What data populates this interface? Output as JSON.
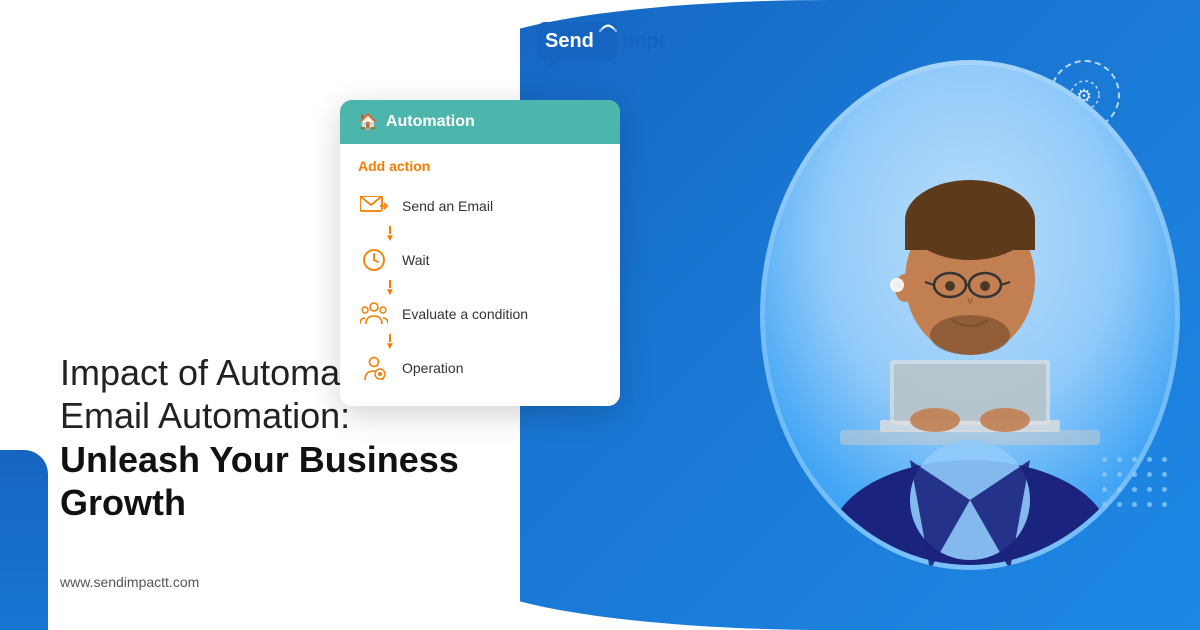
{
  "logo": {
    "send": "Send",
    "impactt": "impactt",
    "tagline": "Send impactt"
  },
  "headline": {
    "line1": "Impact of Automated",
    "line2": "Email Automation:",
    "line3": "Unleash Your Business",
    "line4": "Growth"
  },
  "website": "www.sendimpactt.com",
  "panel": {
    "header": "Automation",
    "add_action": "Add action",
    "items": [
      {
        "label": "Send an Email",
        "icon": "email"
      },
      {
        "label": "Wait",
        "icon": "clock"
      },
      {
        "label": "Evaluate a condition",
        "icon": "evaluate"
      },
      {
        "label": "Operation",
        "icon": "operation"
      }
    ]
  },
  "colors": {
    "blue_dark": "#1565c0",
    "blue_mid": "#1976d2",
    "blue_light": "#42a5f5",
    "teal": "#4db6ac",
    "orange": "#f57c00",
    "white": "#ffffff",
    "text_dark": "#111111",
    "text_mid": "#333333",
    "text_light": "#555555"
  },
  "dots": {
    "top_left_count": 25,
    "bottom_right_count": 20
  }
}
